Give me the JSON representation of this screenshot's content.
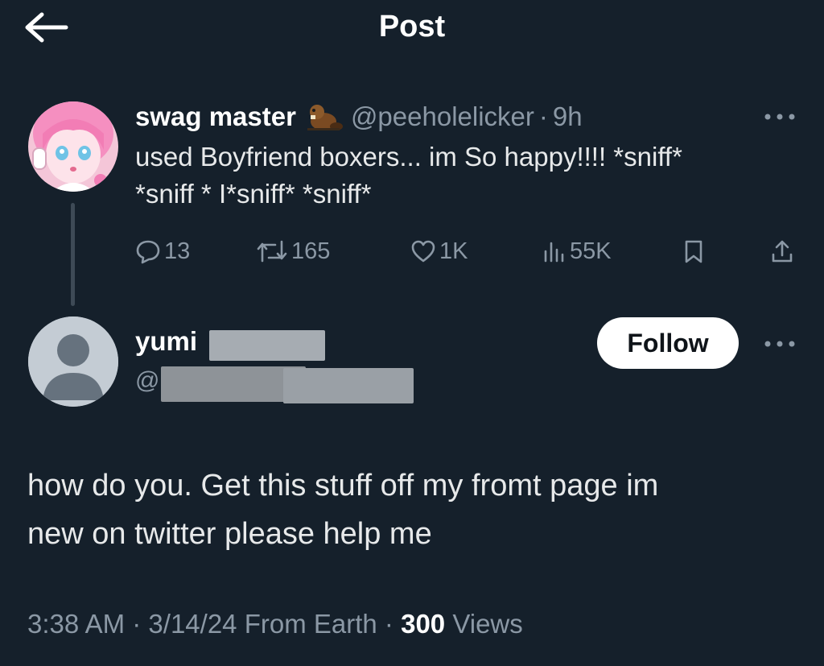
{
  "header": {
    "title": "Post",
    "back_icon": "arrow-left-icon"
  },
  "parent_post": {
    "display_name": "swag master",
    "badge_icon": "beaver-emoji",
    "handle": "@peeholelicker",
    "separator": "·",
    "time": "9h",
    "text_line1": "used Boyfriend boxers... im So happy!!!! *sniff*",
    "text_line2": "*sniff * I*sniff* *sniff*",
    "more_icon": "more-horizontal-icon",
    "actions": {
      "replies": "13",
      "reposts": "165",
      "likes": "1K",
      "views": "55K"
    }
  },
  "reply": {
    "display_name": "yumi",
    "handle_prefix": "@",
    "follow_label": "Follow",
    "text_line1": "how do you. Get this stuff off my fromt page im",
    "text_line2": "new on twitter please help me"
  },
  "meta": {
    "time": "3:38 AM",
    "separator": "·",
    "date": "3/14/24",
    "source": "From Earth",
    "views_count": "300",
    "views_label": "Views"
  },
  "colors": {
    "background": "#15202b",
    "text": "#e7e9ea",
    "secondary": "#8b98a5",
    "follow_button": "#ffffff"
  }
}
